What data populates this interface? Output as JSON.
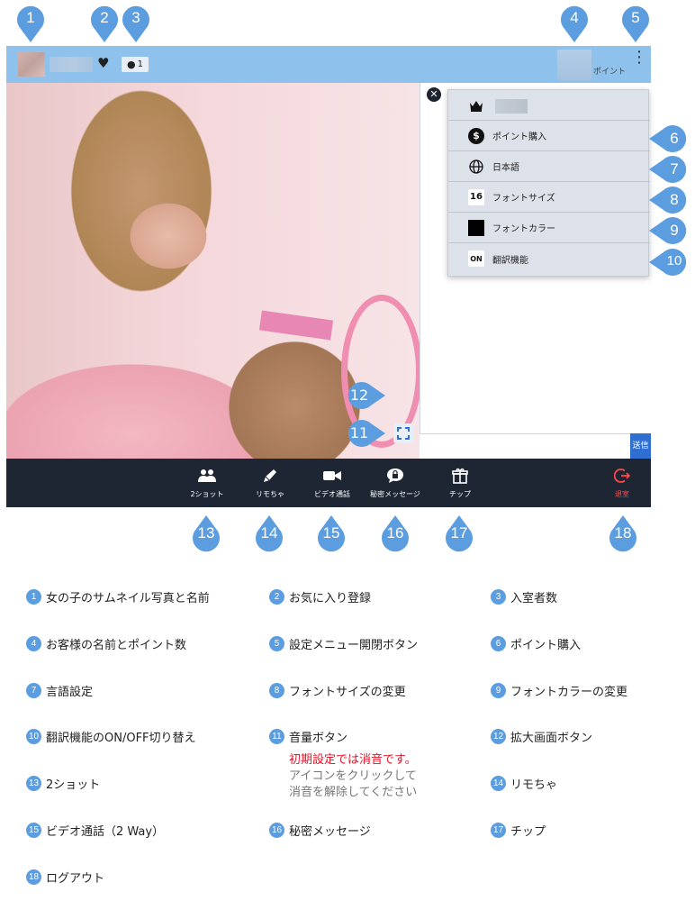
{
  "pins_top": [
    "1",
    "2",
    "3",
    "4",
    "5"
  ],
  "pins_side": [
    "6",
    "7",
    "8",
    "9",
    "10"
  ],
  "pins_overlay": [
    "12",
    "11"
  ],
  "pins_bottom": [
    "13",
    "14",
    "15",
    "16",
    "17",
    "18"
  ],
  "topbar": {
    "favorite_icon": "heart-icon",
    "viewer_icon": "chat-bubble-icon",
    "viewer_count": "1",
    "points_label": "ポイント",
    "menu_icon": "kebab-menu-icon"
  },
  "chat": {
    "close_icon": "close-icon",
    "send_label": "送信"
  },
  "menu": {
    "items": [
      {
        "icon": "crown-icon",
        "label": ""
      },
      {
        "icon": "dollar-icon",
        "label": "ポイント購入"
      },
      {
        "icon": "globe-icon",
        "label": "日本語"
      },
      {
        "icon": "font-size-icon",
        "label": "フォントサイズ",
        "badge": "16"
      },
      {
        "icon": "font-color-icon",
        "label": "フォントカラー",
        "color": "#000000"
      },
      {
        "icon": "translate-toggle-icon",
        "label": "翻訳機能",
        "badge": "ON"
      }
    ]
  },
  "bottombar": {
    "items": [
      {
        "icon": "two-shot-icon",
        "label": "2ショット"
      },
      {
        "icon": "remote-toy-icon",
        "label": "リモちゃ"
      },
      {
        "icon": "video-call-icon",
        "label": "ビデオ通話"
      },
      {
        "icon": "secret-message-icon",
        "label": "秘密メッセージ"
      },
      {
        "icon": "gift-icon",
        "label": "チップ"
      },
      {
        "icon": "exit-icon",
        "label": "退室"
      }
    ]
  },
  "legend": [
    {
      "num": "1",
      "text": "女の子のサムネイル写真と名前"
    },
    {
      "num": "2",
      "text": "お気に入り登録"
    },
    {
      "num": "3",
      "text": "入室者数"
    },
    {
      "num": "4",
      "text": "お客様の名前とポイント数"
    },
    {
      "num": "5",
      "text": "設定メニュー開閉ボタン"
    },
    {
      "num": "6",
      "text": "ポイント購入"
    },
    {
      "num": "7",
      "text": "言語設定"
    },
    {
      "num": "8",
      "text": "フォントサイズの変更"
    },
    {
      "num": "9",
      "text": "フォントカラーの変更"
    },
    {
      "num": "10",
      "text": "翻訳機能のON/OFF切り替え"
    },
    {
      "num": "11",
      "text": "音量ボタン"
    },
    {
      "num": "12",
      "text": "拡大画面ボタン"
    },
    {
      "num": "13",
      "text": "2ショット"
    },
    {
      "num": "14",
      "text": "リモちゃ"
    },
    {
      "num": "15",
      "text": "ビデオ通話（2 Way）"
    },
    {
      "num": "16",
      "text": "秘密メッセージ"
    },
    {
      "num": "17",
      "text": "チップ"
    },
    {
      "num": "18",
      "text": "ログアウト"
    }
  ],
  "volume_note": {
    "red": "初期設定では消音です。",
    "grey1": "アイコンをクリックして",
    "grey2": "消音を解除してください"
  },
  "colors": {
    "pin": "#5c9de0",
    "topbar": "#8ec1ec",
    "bottombar": "#1e2533",
    "send": "#2f6fd2",
    "exit": "#ff4a4a",
    "note_red": "#e0152a"
  }
}
